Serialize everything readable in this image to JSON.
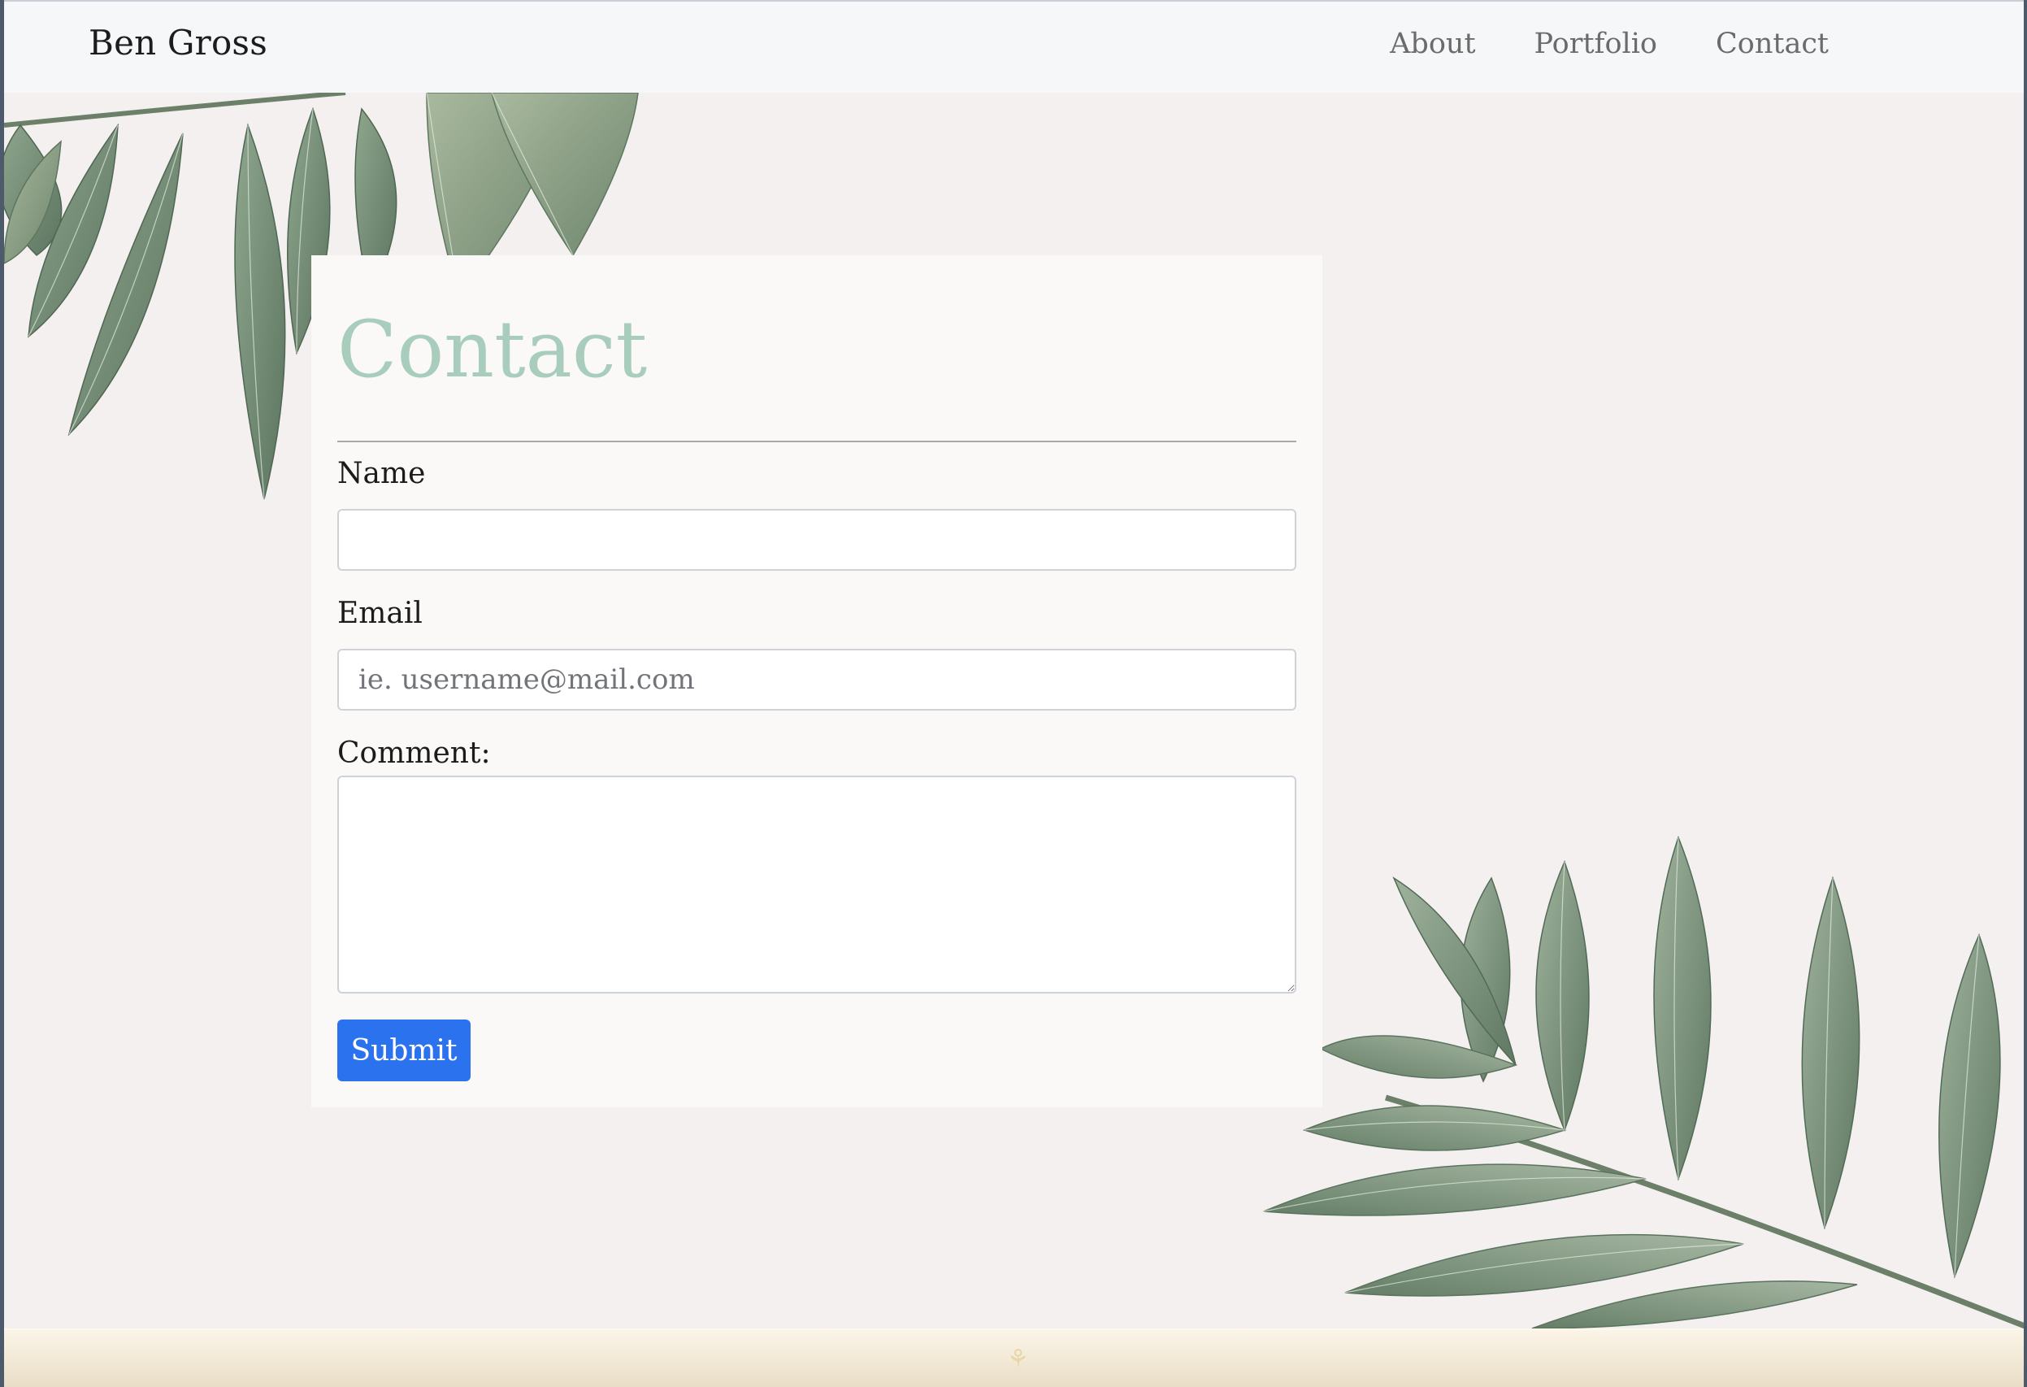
{
  "navbar": {
    "brand": "Ben Gross",
    "links": [
      {
        "label": "About"
      },
      {
        "label": "Portfolio"
      },
      {
        "label": "Contact"
      }
    ]
  },
  "contact": {
    "title": "Contact",
    "name_label": "Name",
    "name_value": "",
    "email_label": "Email",
    "email_value": "",
    "email_placeholder": "ie. username@mail.com",
    "comment_label": "Comment:",
    "comment_value": "",
    "submit_label": "Submit"
  },
  "footer": {
    "icon": "leaf-ornament-icon"
  },
  "colors": {
    "page_bg": "#f4f0ef",
    "card_bg": "#faf9f8",
    "title": "#a8cdbd",
    "submit": "#2b72ee",
    "leaf": "#6f8a6f"
  }
}
